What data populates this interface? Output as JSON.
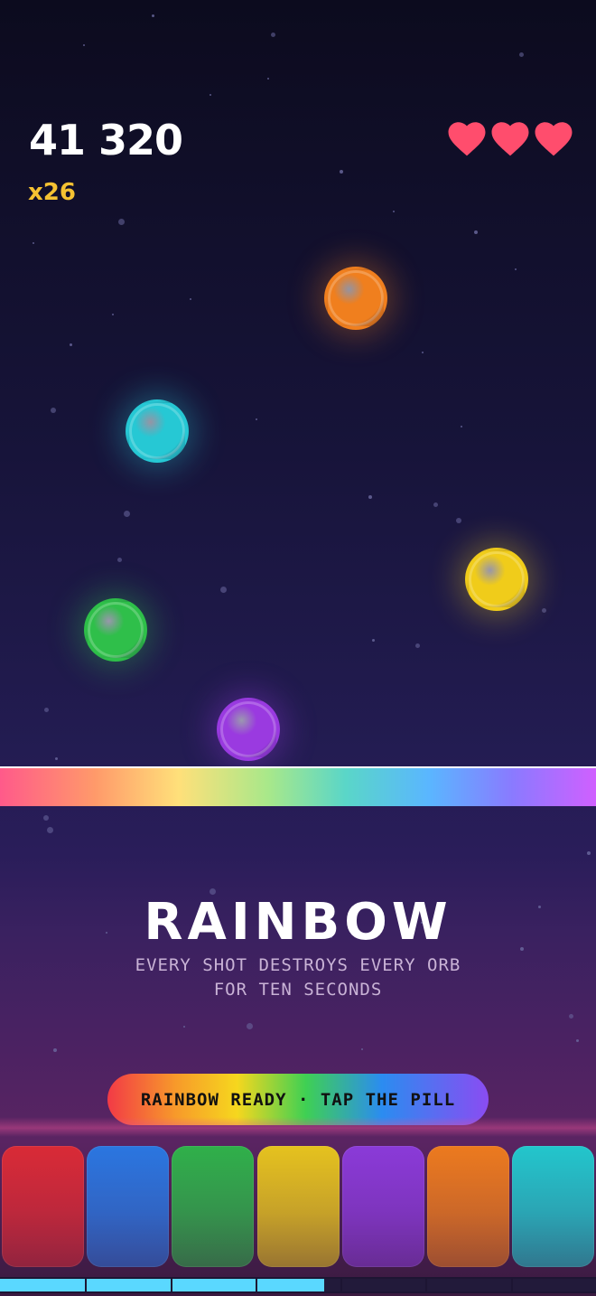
{
  "hud": {
    "score": "41 320",
    "combo": "x26",
    "lives": 3,
    "life_color": "#ff4d6d"
  },
  "orbs": [
    {
      "name": "orange-orb",
      "color": "#f07f1e"
    },
    {
      "name": "cyan-orb",
      "color": "#26c8d4"
    },
    {
      "name": "yellow-orb",
      "color": "#f0cc1a"
    },
    {
      "name": "green-orb",
      "color": "#2fbf4a"
    },
    {
      "name": "purple-orb",
      "color": "#9a3ae0"
    }
  ],
  "powerup": {
    "title": "RAINBOW",
    "subtitle_line1": "EVERY SHOT DESTROYS EVERY ORB",
    "subtitle_line2": "FOR TEN SECONDS",
    "pill_label": "RAINBOW READY · TAP THE PILL"
  },
  "color_buttons": [
    {
      "name": "red",
      "color": "#d92a36"
    },
    {
      "name": "blue",
      "color": "#2a76e0"
    },
    {
      "name": "green",
      "color": "#2fb04a"
    },
    {
      "name": "yellow",
      "color": "#e5c21e"
    },
    {
      "name": "purple",
      "color": "#8a3ad8"
    },
    {
      "name": "orange",
      "color": "#ec7a1e"
    },
    {
      "name": "cyan",
      "color": "#22c6cc"
    }
  ],
  "energy": {
    "segments": 7,
    "filled": 3.8,
    "fill_color": "#5ad8ff"
  }
}
